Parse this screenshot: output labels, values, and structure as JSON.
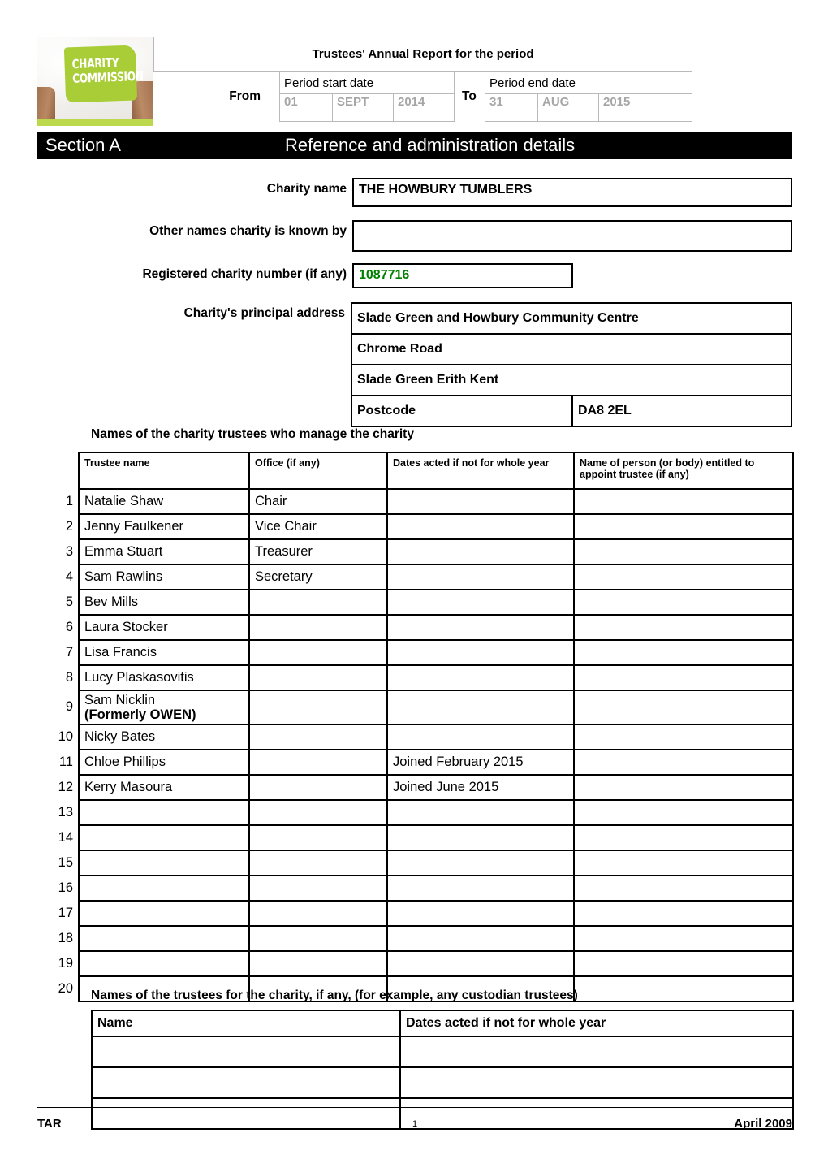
{
  "document": {
    "title": "Trustees' Annual Report for the period"
  },
  "logo": {
    "badge_line1": "CHARITY",
    "badge_line2": "COMMISSION",
    "brand_green": "#a9cd37"
  },
  "period": {
    "start_header": "Period start date",
    "end_header": "Period end date",
    "from_label": "From",
    "to_label": "To",
    "start_day": "01",
    "start_month": "SEPT",
    "start_year": "2014",
    "end_day": "31",
    "end_month": "AUG",
    "end_year": "2015",
    "value_color": "#a6a6a6"
  },
  "section": {
    "label": "Section A",
    "title": "Reference and administration details"
  },
  "fields": {
    "charity_name_label": "Charity name",
    "charity_name_value": "THE HOWBURY TUMBLERS",
    "other_names_label": "Other names charity is known by",
    "other_names_value": "",
    "charity_number_label": "Registered charity number (if any)",
    "charity_number_value": "1087716",
    "charity_number_color": "#008000",
    "address_label": "Charity's principal address",
    "address_line1": "Slade Green and Howbury Community Centre",
    "address_line2": "Chrome Road",
    "address_line3": "Slade Green   Erith  Kent",
    "postcode_label": "Postcode",
    "postcode_value": "DA8 2EL"
  },
  "trustees": {
    "heading": "Names of the charity trustees who manage the charity",
    "columns": [
      "Trustee name",
      "Office (if any)",
      "Dates acted if not for whole year",
      "Name of person (or body) entitled to appoint trustee (if any)"
    ],
    "rows": [
      {
        "no": "1",
        "name": "Natalie Shaw",
        "name2": "",
        "office": "Chair",
        "dates": "",
        "appointer": ""
      },
      {
        "no": "2",
        "name": "Jenny Faulkener",
        "name2": "",
        "office": "Vice Chair",
        "dates": "",
        "appointer": ""
      },
      {
        "no": "3",
        "name": "Emma Stuart",
        "name2": "",
        "office": "Treasurer",
        "dates": "",
        "appointer": ""
      },
      {
        "no": "4",
        "name": "Sam Rawlins",
        "name2": "",
        "office": "Secretary",
        "dates": "",
        "appointer": ""
      },
      {
        "no": "5",
        "name": "Bev Mills",
        "name2": "",
        "office": "",
        "dates": "",
        "appointer": ""
      },
      {
        "no": "6",
        "name": "Laura Stocker",
        "name2": "",
        "office": "",
        "dates": "",
        "appointer": ""
      },
      {
        "no": "7",
        "name": "Lisa Francis",
        "name2": "",
        "office": "",
        "dates": "",
        "appointer": ""
      },
      {
        "no": "8",
        "name": "Lucy Plaskasovitis",
        "name2": "",
        "office": "",
        "dates": "",
        "appointer": ""
      },
      {
        "no": "9",
        "name": "Sam Nicklin",
        "name2": "(Formerly OWEN)",
        "office": "",
        "dates": "",
        "appointer": ""
      },
      {
        "no": "10",
        "name": "Nicky Bates",
        "name2": "",
        "office": "",
        "dates": "",
        "appointer": ""
      },
      {
        "no": "11",
        "name": "Chloe Phillips",
        "name2": "",
        "office": "",
        "dates": "Joined February 2015",
        "appointer": ""
      },
      {
        "no": "12",
        "name": "Kerry Masoura",
        "name2": "",
        "office": "",
        "dates": "Joined June 2015",
        "appointer": ""
      },
      {
        "no": "13",
        "name": "",
        "name2": "",
        "office": "",
        "dates": "",
        "appointer": ""
      },
      {
        "no": "14",
        "name": "",
        "name2": "",
        "office": "",
        "dates": "",
        "appointer": ""
      },
      {
        "no": "15",
        "name": "",
        "name2": "",
        "office": "",
        "dates": "",
        "appointer": ""
      },
      {
        "no": "16",
        "name": "",
        "name2": "",
        "office": "",
        "dates": "",
        "appointer": ""
      },
      {
        "no": "17",
        "name": "",
        "name2": "",
        "office": "",
        "dates": "",
        "appointer": ""
      },
      {
        "no": "18",
        "name": "",
        "name2": "",
        "office": "",
        "dates": "",
        "appointer": ""
      },
      {
        "no": "19",
        "name": "",
        "name2": "",
        "office": "",
        "dates": "",
        "appointer": ""
      },
      {
        "no": "20",
        "name": "",
        "name2": "",
        "office": "",
        "dates": "",
        "appointer": ""
      }
    ]
  },
  "custodian": {
    "heading": "Names of the trustees for the charity, if any, (for example, any custodian trustees)",
    "columns": [
      "Name",
      "Dates acted if not for whole year"
    ],
    "rows": [
      {
        "name": "",
        "dates": ""
      },
      {
        "name": "",
        "dates": ""
      },
      {
        "name": "",
        "dates": ""
      }
    ]
  },
  "footer": {
    "left": "TAR",
    "page": "1",
    "right": "April 2009"
  }
}
